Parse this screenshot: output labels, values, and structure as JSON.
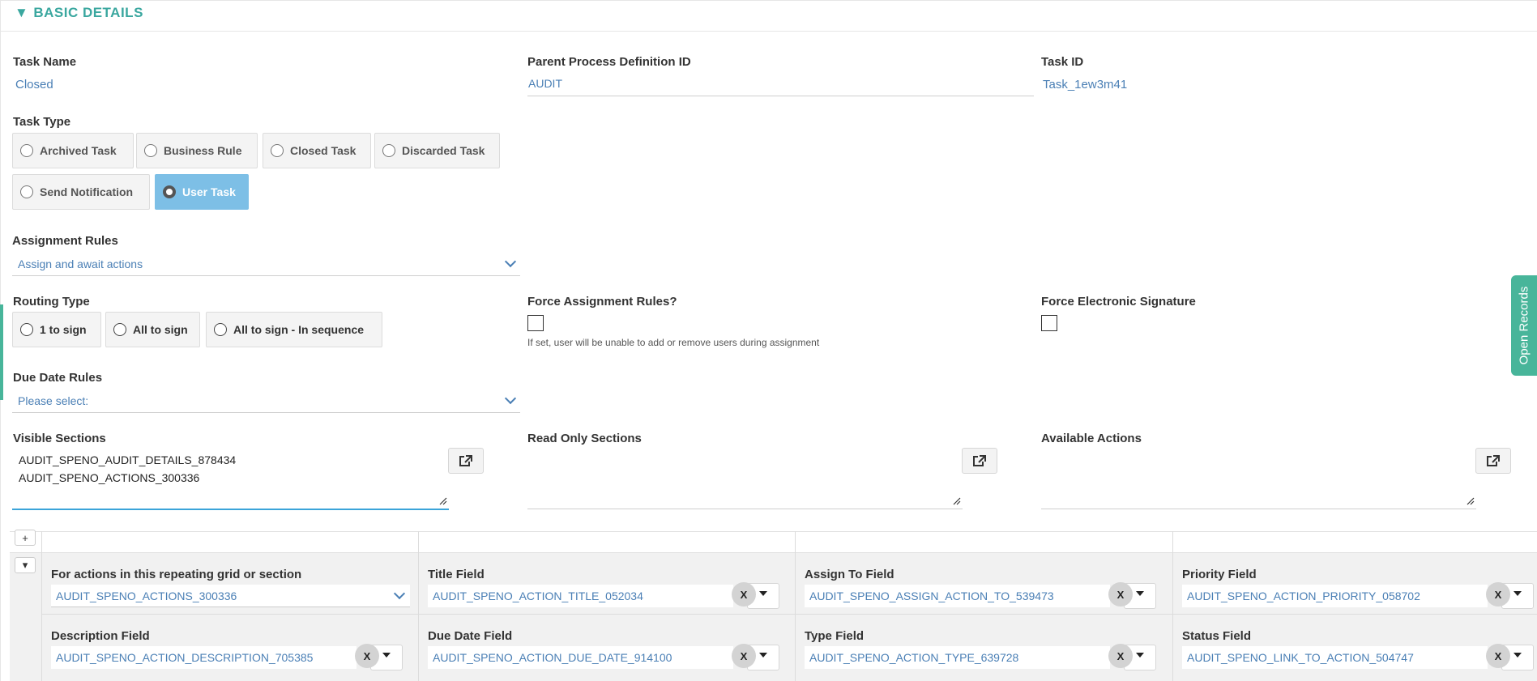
{
  "section": {
    "title": "BASIC DETAILS"
  },
  "task_name": {
    "label": "Task Name",
    "value": "Closed"
  },
  "parent_process": {
    "label": "Parent Process Definition ID",
    "value": "AUDIT"
  },
  "task_id": {
    "label": "Task ID",
    "value": "Task_1ew3m41"
  },
  "task_type": {
    "label": "Task Type",
    "options": [
      "Archived Task",
      "Business Rule",
      "Closed Task",
      "Discarded Task",
      "Send Notification",
      "User Task"
    ],
    "selected": "User Task"
  },
  "assignment_rules": {
    "label": "Assignment Rules",
    "value": "Assign and await actions"
  },
  "routing_type": {
    "label": "Routing Type",
    "options": [
      "1 to sign",
      "All to sign",
      "All to sign - In sequence"
    ]
  },
  "force_assignment": {
    "label": "Force Assignment Rules?",
    "hint": "If set, user will be unable to add or remove users during assignment"
  },
  "force_esign": {
    "label": "Force Electronic Signature"
  },
  "due_date_rules": {
    "label": "Due Date Rules",
    "placeholder": "Please select:"
  },
  "visible_sections": {
    "label": "Visible Sections",
    "lines": [
      "AUDIT_SPENO_AUDIT_DETAILS_878434",
      "AUDIT_SPENO_ACTIONS_300336"
    ]
  },
  "read_only_sections": {
    "label": "Read Only Sections"
  },
  "available_actions": {
    "label": "Available Actions"
  },
  "grid": {
    "add_label": "+",
    "collapse_label": "▾",
    "repeat_label": "For actions in this repeating grid or section",
    "repeat_value": "AUDIT_SPENO_ACTIONS_300336",
    "title_label": "Title Field",
    "title_value": "AUDIT_SPENO_ACTION_TITLE_052034",
    "assign_label": "Assign To Field",
    "assign_value": "AUDIT_SPENO_ASSIGN_ACTION_TO_539473",
    "priority_label": "Priority Field",
    "priority_value": "AUDIT_SPENO_ACTION_PRIORITY_058702",
    "desc_label": "Description Field",
    "desc_value": "AUDIT_SPENO_ACTION_DESCRIPTION_705385",
    "due_label": "Due Date Field",
    "due_value": "AUDIT_SPENO_ACTION_DUE_DATE_914100",
    "type_label": "Type Field",
    "type_value": "AUDIT_SPENO_ACTION_TYPE_639728",
    "status_label": "Status Field",
    "status_value": "AUDIT_SPENO_LINK_TO_ACTION_504747",
    "clear_label": "X"
  },
  "side_tab": {
    "label": "Open Records"
  },
  "colors": {
    "accent": "#3aa79f",
    "selected": "#7dbfe6",
    "value_text": "#4a7fb5",
    "side_tab": "#48b59a"
  }
}
